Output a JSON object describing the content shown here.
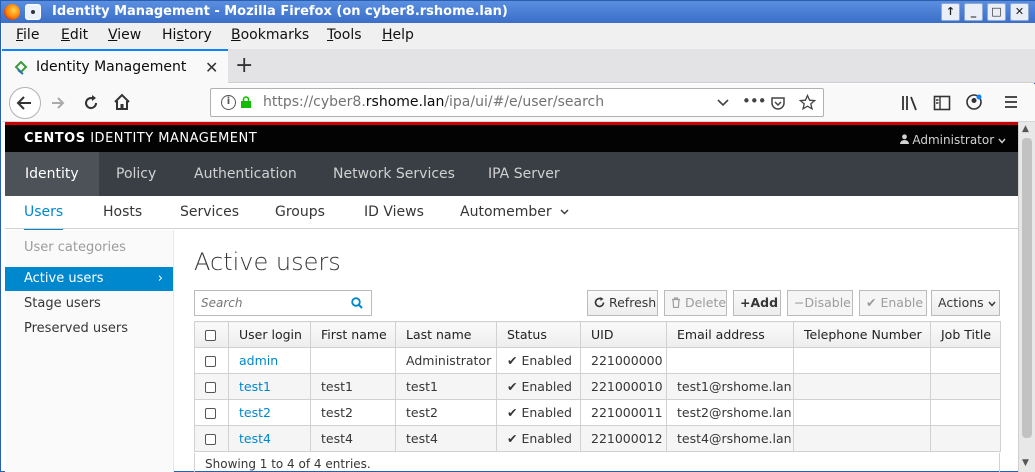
{
  "window": {
    "title": "Identity Management - Mozilla Firefox (on cyber8.rshome.lan)",
    "controls": [
      "↑",
      "_",
      "□",
      "✕"
    ]
  },
  "menubar": {
    "items": [
      {
        "u": "F",
        "rest": "ile"
      },
      {
        "u": "E",
        "rest": "dit"
      },
      {
        "u": "V",
        "rest": "iew"
      },
      {
        "pre": "Hi",
        "u": "s",
        "rest": "tory"
      },
      {
        "u": "B",
        "rest": "ookmarks"
      },
      {
        "u": "T",
        "rest": "ools"
      },
      {
        "u": "H",
        "rest": "elp"
      }
    ]
  },
  "tab": {
    "label": "Identity Management",
    "close": "✕",
    "new": "+"
  },
  "urlbar": {
    "prefix": "https://cyber8.",
    "domain": "rshome.lan",
    "path": "/ipa/ui/#/e/user/search",
    "more": "•••"
  },
  "header": {
    "brand_bold": "CENTOS",
    "brand_rest": " IDENTITY MANAGEMENT",
    "user": "Administrator"
  },
  "primary_nav": [
    "Identity",
    "Policy",
    "Authentication",
    "Network Services",
    "IPA Server"
  ],
  "secondary_nav": [
    "Users",
    "Hosts",
    "Services",
    "Groups",
    "ID Views",
    "Automember"
  ],
  "sidebar": {
    "category": "User categories",
    "items": [
      "Active users",
      "Stage users",
      "Preserved users"
    ],
    "chevron": "›"
  },
  "main": {
    "title": "Active users",
    "search_placeholder": "Search",
    "buttons": {
      "refresh": "Refresh",
      "delete": "Delete",
      "add": "Add",
      "disable": "Disable",
      "enable": "Enable",
      "actions": "Actions"
    }
  },
  "table": {
    "columns": [
      "User login",
      "First name",
      "Last name",
      "Status",
      "UID",
      "Email address",
      "Telephone Number",
      "Job Title"
    ],
    "rows": [
      {
        "login": "admin",
        "first": "",
        "last": "Administrator",
        "status": "Enabled",
        "uid": "221000000",
        "email": "",
        "phone": "",
        "job": ""
      },
      {
        "login": "test1",
        "first": "test1",
        "last": "test1",
        "status": "Enabled",
        "uid": "221000010",
        "email": "test1@rshome.lan",
        "phone": "",
        "job": ""
      },
      {
        "login": "test2",
        "first": "test2",
        "last": "test2",
        "status": "Enabled",
        "uid": "221000011",
        "email": "test2@rshome.lan",
        "phone": "",
        "job": ""
      },
      {
        "login": "test4",
        "first": "test4",
        "last": "test4",
        "status": "Enabled",
        "uid": "221000012",
        "email": "test4@rshome.lan",
        "phone": "",
        "job": ""
      }
    ],
    "footer": "Showing 1 to 4 of 4 entries."
  },
  "colors": {
    "accent": "#0088ce",
    "header_red": "#cc0000",
    "nav_dark": "#393f44",
    "top_black": "#030303"
  }
}
